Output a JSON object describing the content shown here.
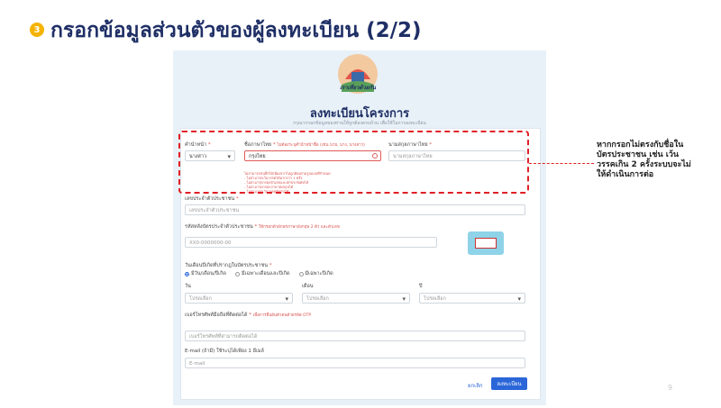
{
  "slide": {
    "step_number": "3",
    "title": "กรอกข้อมูลส่วนตัวของผู้ลงทะเบียน (2/2)",
    "page_number": "9",
    "callout": "หากกรอกไม่ตรงกับชื่อในบัตรประชาชน เช่น เว้นวรรคเกิน 2 ครั้งระบบจะไม่ให้ดำเนินการต่อ"
  },
  "form": {
    "logo_caption": "เราเที่ยวด้วยกัน",
    "title": "ลงทะเบียนโครงการ",
    "subtitle": "กรุณากรอกข้อมูลของท่านให้ถูกต้องครบถ้วน เพื่อใช้ในการลงทะเบียน",
    "prefix": {
      "label": "คำนำหน้า",
      "value": "นางสาว"
    },
    "first_name": {
      "label": "ชื่อภาษาไทย",
      "note": "ไม่ต้องระบุคำนำหน้าชื่อ (เช่น นาย, นาง, นางสาว)",
      "value": "กรุงไทย",
      "errors": [
        "ไม่สามารถบันทึกได้เนื่องจากไม่ถูกต้องตามรูปแบบที่กำหนด",
        "- ไม่สามารถเว้นวรรคได้มากกว่า 1 ครั้ง",
        "- ไม่สามารถกรอกตัวเลขและอักขระพิเศษได้",
        "- ไม่สามารถกรอกภาษาอังกฤษได้",
        "- ไม่สามารถเว้นวรรคติดกันได้"
      ]
    },
    "last_name": {
      "label": "นามสกุลภาษาไทย",
      "placeholder": "นามสกุลภาษาไทย"
    },
    "id_number": {
      "label": "เลขประจำตัวประชาชน",
      "placeholder": "เลขประจำตัวประชาชน"
    },
    "laser_code": {
      "label": "รหัสหลังบัตรประจำตัวประชาชน",
      "note": "ให้กรอกตัวอักษรภาษาอังกฤษ 2 ตัว และตัวเลข",
      "placeholder": "XX0-0000000-00"
    },
    "birthdate": {
      "label": "วันเดือนปีเกิดที่ปรากฎในบัตรประชาชน",
      "options": [
        "มีวัน/เดือน/ปีเกิด",
        "มีเฉพาะเดือนและปีเกิด",
        "มีเฉพาะปีเกิด"
      ],
      "day_label": "วัน",
      "month_label": "เดือน",
      "year_label": "ปี",
      "select_placeholder": "โปรดเลือก"
    },
    "phone": {
      "label": "เบอร์โทรศัพท์มือถือที่ติดต่อได้",
      "note": "เพื่อการยืนยันตัวตนด้วยรหัส OTP",
      "placeholder": "เบอร์โทรศัพท์ที่สามารถติดต่อได้"
    },
    "email": {
      "label": "E-mail (ถ้ามี) ใช้ระบุได้เพียง 1 อีเมล์",
      "placeholder": "E-mail"
    },
    "cancel_label": "ยกเลิก",
    "submit_label": "ลงทะเบียน"
  }
}
